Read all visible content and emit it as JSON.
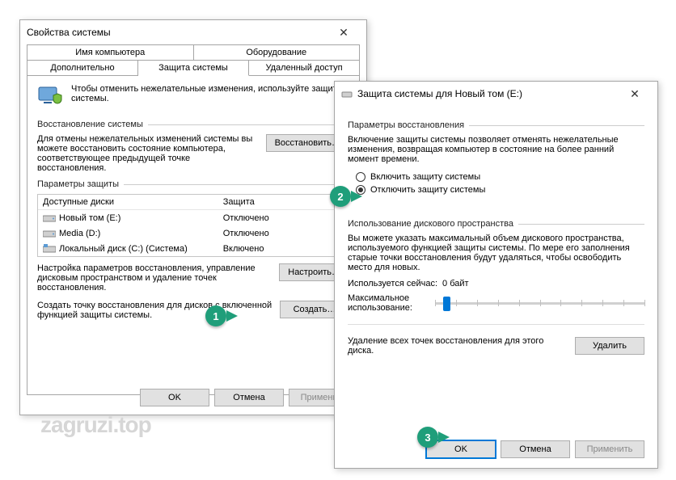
{
  "w1": {
    "title": "Свойства системы",
    "tabs_top": [
      "Имя компьютера",
      "Оборудование"
    ],
    "tabs_bottom": [
      "Дополнительно",
      "Защита системы",
      "Удаленный доступ"
    ],
    "info": "Чтобы отменить нежелательные изменения, используйте защиту системы.",
    "restore_group": "Восстановление системы",
    "restore_text": "Для отмены нежелательных изменений системы вы можете восстановить состояние компьютера, соответствующее предыдущей точке восстановления.",
    "restore_btn": "Восстановить…",
    "params_group": "Параметры защиты",
    "drive_head_drive": "Доступные диски",
    "drive_head_prot": "Защита",
    "drives": [
      {
        "name": "Новый том (E:)",
        "prot": "Отключено"
      },
      {
        "name": "Media (D:)",
        "prot": "Отключено"
      },
      {
        "name": "Локальный диск (C:) (Система)",
        "prot": "Включено"
      }
    ],
    "configure_text": "Настройка параметров восстановления, управление дисковым пространством и удаление точек восстановления.",
    "configure_btn": "Настроить…",
    "create_text": "Создать точку восстановления для дисков с включенной функцией защиты системы.",
    "create_btn": "Создать…",
    "ok": "OK",
    "cancel": "Отмена",
    "apply": "Применить"
  },
  "w2": {
    "title": "Защита системы для Новый том (E:)",
    "grp1": "Параметры восстановления",
    "desc1": "Включение защиты системы позволяет отменять нежелательные изменения, возвращая компьютер в состояние на более ранний момент времени.",
    "radio_on": "Включить защиту системы",
    "radio_off": "Отключить защиту системы",
    "grp2": "Использование дискового пространства",
    "desc2": "Вы можете указать максимальный объем дискового пространства, используемого функцией защиты системы. По мере его заполнения старые точки восстановления будут удаляться, чтобы освободить место для новых.",
    "used_label": "Используется сейчас:",
    "used_value": "0 байт",
    "max_use": "Максимальное использование:",
    "del_text": "Удаление всех точек восстановления для этого диска.",
    "delete_btn": "Удалить",
    "ok": "OK",
    "cancel": "Отмена",
    "apply": "Применить"
  },
  "callouts": {
    "c1": "1",
    "c2": "2",
    "c3": "3"
  },
  "watermark": "zagruzi.top"
}
